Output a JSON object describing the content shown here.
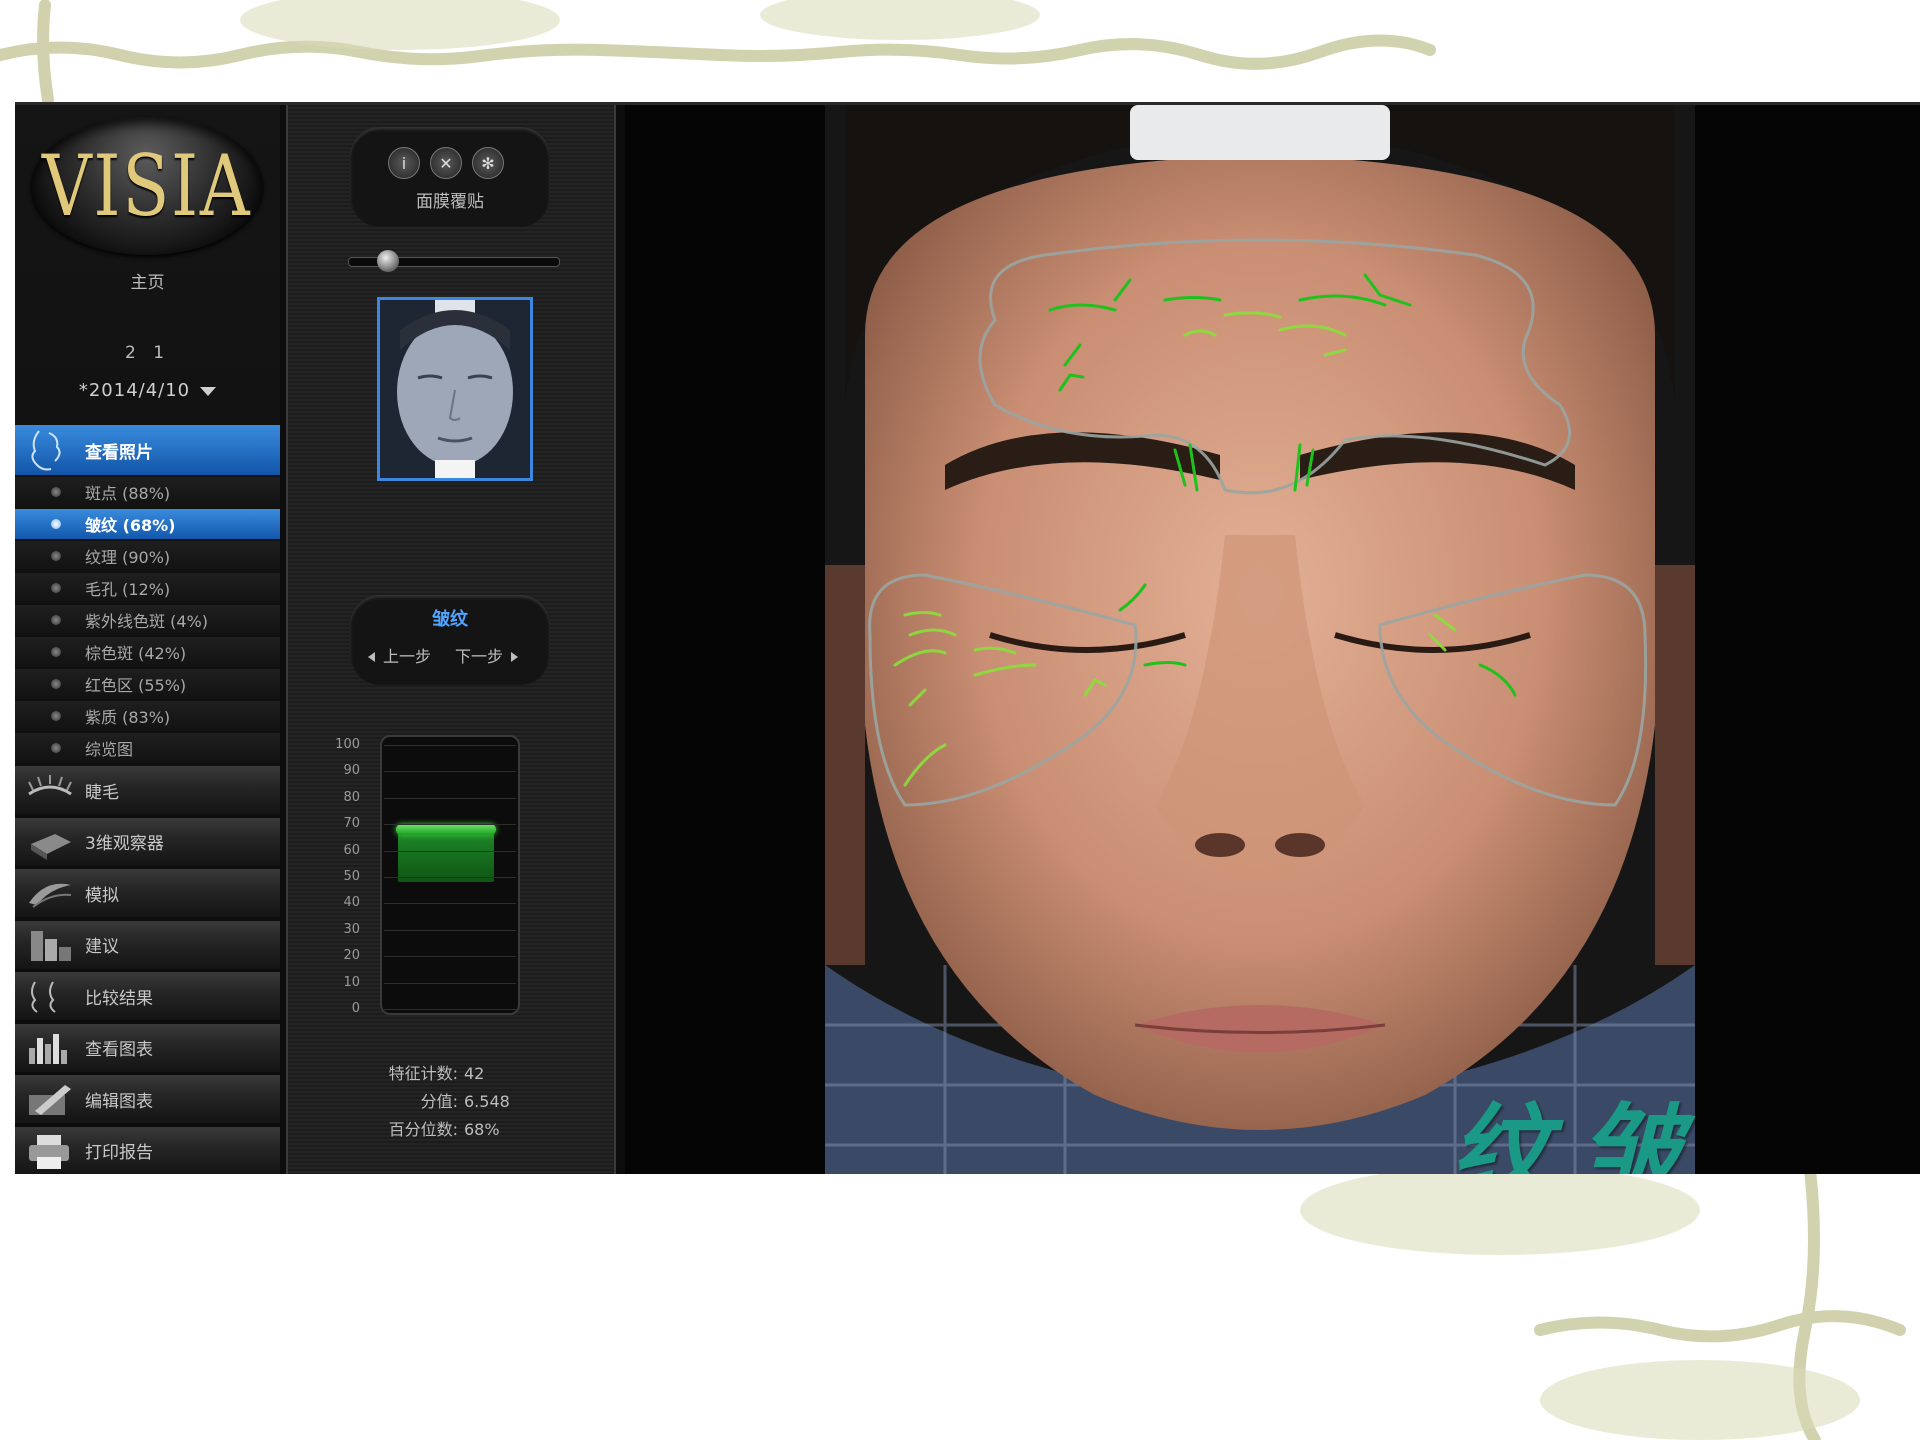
{
  "app": {
    "logo_text": "VISIA",
    "home_label": "主页",
    "patient_number": "2 1",
    "date": "*2014/4/10"
  },
  "sidebar": {
    "view_photos_label": "查看照片",
    "sub_items": [
      {
        "label": "斑点 (88%)",
        "active": false
      },
      {
        "label": "皱纹 (68%)",
        "active": true
      },
      {
        "label": "纹理 (90%)",
        "active": false
      },
      {
        "label": "毛孔 (12%)",
        "active": false
      },
      {
        "label": "紫外线色斑 (4%)",
        "active": false
      },
      {
        "label": "棕色斑 (42%)",
        "active": false
      },
      {
        "label": "红色区 (55%)",
        "active": false
      },
      {
        "label": "紫质 (83%)",
        "active": false
      },
      {
        "label": "综览图",
        "active": false
      }
    ],
    "tools": [
      {
        "label": "睫毛",
        "icon": "eyelash-icon"
      },
      {
        "label": "3维观察器",
        "icon": "3d-viewer-icon"
      },
      {
        "label": "模拟",
        "icon": "simulation-icon"
      },
      {
        "label": "建议",
        "icon": "suggestion-icon"
      },
      {
        "label": "比较结果",
        "icon": "compare-icon"
      },
      {
        "label": "查看图表",
        "icon": "chart-icon"
      },
      {
        "label": "编辑图表",
        "icon": "edit-chart-icon"
      },
      {
        "label": "打印报告",
        "icon": "printer-icon"
      }
    ]
  },
  "panel": {
    "overlay_label": "面膜覆贴",
    "overlay_buttons": [
      "info-icon",
      "close-icon",
      "settings-icon"
    ],
    "zoom_level": 0.15,
    "nav_title": "皱纹",
    "prev_label": "上一步",
    "next_label": "下一步",
    "gauge": {
      "ticks": [
        "100",
        "90",
        "80",
        "70",
        "60",
        "50",
        "40",
        "30",
        "20",
        "10",
        "0"
      ],
      "value_percent": 68
    },
    "stats": [
      {
        "label": "特征计数:",
        "value": "42"
      },
      {
        "label": "分值:",
        "value": "6.548"
      },
      {
        "label": "百分位数:",
        "value": "68%"
      }
    ]
  },
  "overlay_text": "纹皱",
  "colors": {
    "accent_blue": "#2f7fd6",
    "wrinkle_green": "#3fcf2a",
    "mask_outline": "#9aa5a2",
    "watermark": "#1a9a86",
    "vine": "#b8ba86"
  }
}
